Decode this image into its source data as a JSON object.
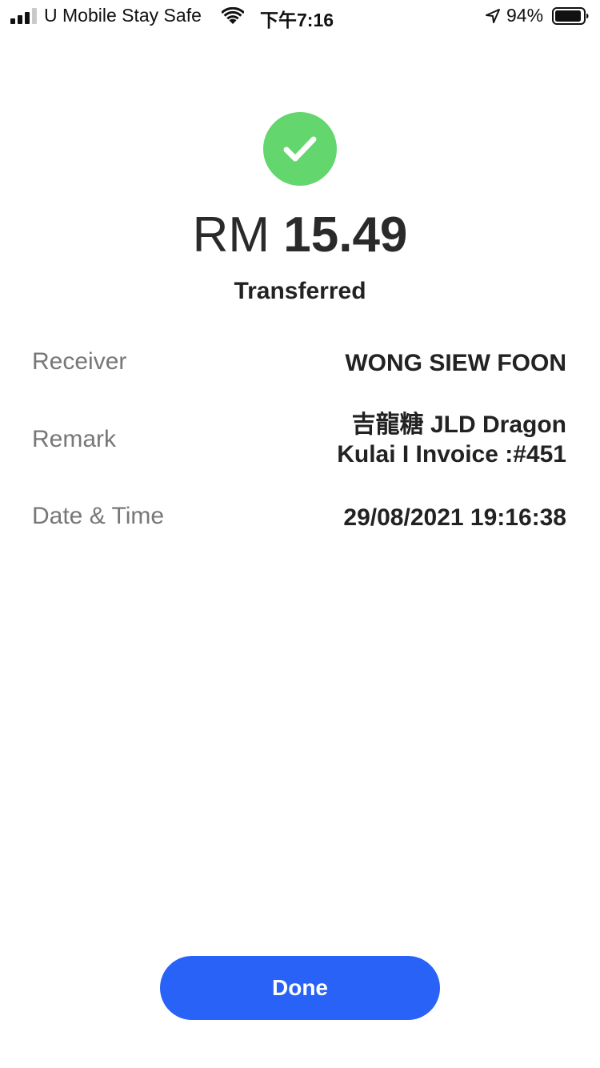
{
  "status_bar": {
    "carrier": "U Mobile Stay Safe",
    "time": "下午7:16",
    "battery_percent": "94%",
    "battery_level": 0.94,
    "signal_bars_filled": 3,
    "signal_bars_total": 4
  },
  "receipt": {
    "currency": "RM",
    "amount": "15.49",
    "status": "Transferred",
    "accent_color": "#63d66d"
  },
  "details": {
    "receiver_label": "Receiver",
    "receiver_value": "WONG SIEW FOON",
    "remark_label": "Remark",
    "remark_line1": "吉龍糖 JLD Dragon",
    "remark_line2": "Kulai I Invoice :#451",
    "datetime_label": "Date & Time",
    "datetime_value": "29/08/2021 19:16:38"
  },
  "actions": {
    "done_label": "Done",
    "done_color": "#2962f6"
  },
  "icons": {
    "signal": "cellular-signal-icon",
    "wifi": "wifi-icon",
    "location": "location-arrow-icon",
    "battery": "battery-icon",
    "success": "checkmark-circle-icon"
  }
}
